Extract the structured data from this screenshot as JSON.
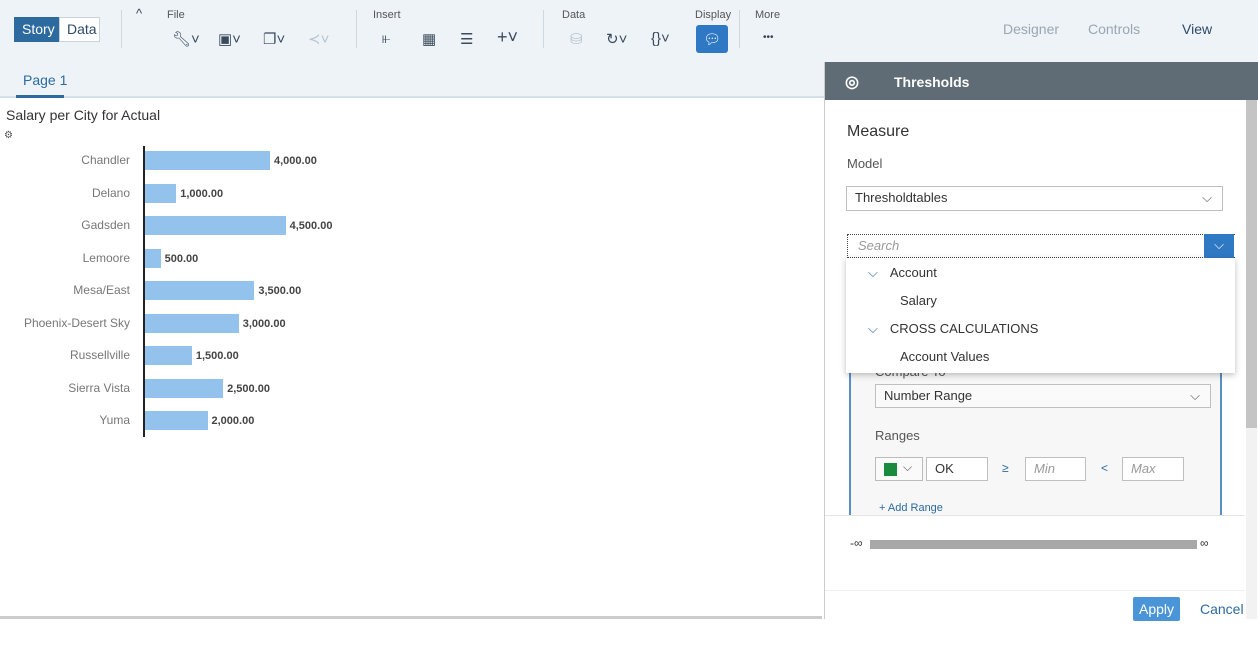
{
  "toolbar": {
    "story": "Story",
    "data": "Data",
    "groups": {
      "file": "File",
      "insert": "Insert",
      "data": "Data",
      "display": "Display",
      "more": "More"
    },
    "more_icon": "•••",
    "modes": {
      "designer": "Designer",
      "controls": "Controls",
      "view": "View"
    }
  },
  "page_tab": "Page 1",
  "chart_data": {
    "type": "bar",
    "orientation": "horizontal",
    "title": "Salary per City for Actual",
    "categories": [
      "Chandler",
      "Delano",
      "Gadsden",
      "Lemoore",
      "Mesa/East",
      "Phoenix-Desert Sky",
      "Russellville",
      "Sierra Vista",
      "Yuma"
    ],
    "values": [
      4000,
      1000,
      4500,
      500,
      3500,
      3000,
      1500,
      2500,
      2000
    ],
    "labels": [
      "4,000.00",
      "1,000.00",
      "4,500.00",
      "500.00",
      "3,500.00",
      "3,000.00",
      "1,500.00",
      "2,500.00",
      "2,000.00"
    ],
    "color": "#93c2ec"
  },
  "panel": {
    "title": "Thresholds",
    "measure": "Measure",
    "model_label": "Model",
    "model_value": "Thresholdtables",
    "search_placeholder": "Search",
    "dropdown": [
      {
        "label": "Account",
        "type": "group"
      },
      {
        "label": "Salary",
        "type": "item"
      },
      {
        "label": "CROSS CALCULATIONS",
        "type": "group"
      },
      {
        "label": "Account Values",
        "type": "item"
      }
    ],
    "compare_to_label": "Compare To",
    "compare_to_value": "Number Range",
    "ranges_label": "Ranges",
    "range": {
      "color": "#1a8a3c",
      "name": "OK",
      "gte": "≥",
      "min_placeholder": "Min",
      "lt": "<",
      "max_placeholder": "Max"
    },
    "add_range": "+ Add Range",
    "neg_inf": "-∞",
    "pos_inf": "∞",
    "apply": "Apply",
    "cancel": "Cancel"
  }
}
